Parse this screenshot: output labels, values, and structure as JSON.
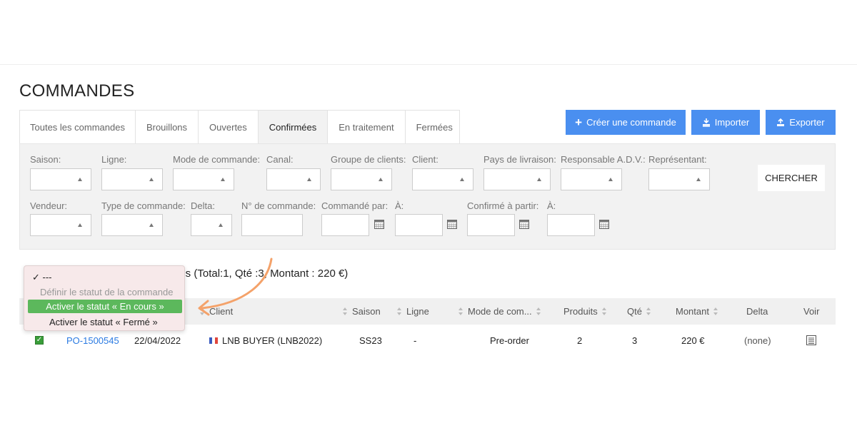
{
  "page": {
    "title": "COMMANDES"
  },
  "tabs": [
    {
      "label": "Toutes les commandes"
    },
    {
      "label": "Brouillons"
    },
    {
      "label": "Ouvertes"
    },
    {
      "label": "Confirmées"
    },
    {
      "label": "En traitement"
    },
    {
      "label": "Fermées"
    }
  ],
  "actions": {
    "create": "Créer une commande",
    "import": "Importer",
    "export": "Exporter"
  },
  "filters": {
    "saison": "Saison:",
    "ligne": "Ligne:",
    "mode": "Mode de commande:",
    "canal": "Canal:",
    "groupe": "Groupe de clients:",
    "client": "Client:",
    "pays": "Pays de livraison:",
    "responsable": "Responsable A.D.V.:",
    "representant": "Représentant:",
    "vendeur": "Vendeur:",
    "type": "Type de commande:",
    "delta": "Delta:",
    "numero": "N° de commande:",
    "commande_par": "Commandé par:",
    "a1": "À:",
    "confirme": "Confirmé à partir:",
    "a2": "À:",
    "search_button": "CHERCHER"
  },
  "summary": "ées (Total:1, Qté :3, Montant : 220 €)",
  "dropdown": {
    "selected": "✓ ---",
    "header": "Définir le statut de la commande",
    "option1": "Activer le statut « En cours »",
    "option2": "Activer le statut « Fermé »"
  },
  "table": {
    "headers": {
      "client": "Client",
      "saison": "Saison",
      "ligne": "Ligne",
      "mode": "Mode de com...",
      "produits": "Produits",
      "qte": "Qté",
      "montant": "Montant",
      "delta": "Delta",
      "voir": "Voir"
    },
    "row": {
      "order": "PO-1500545",
      "date": "22/04/2022",
      "client": "LNB BUYER (LNB2022)",
      "saison": "SS23",
      "ligne": "-",
      "mode": "Pre-order",
      "produits": "2",
      "qte": "3",
      "montant": "220 €",
      "delta": "(none)"
    }
  },
  "colors": {
    "accent_blue": "#4a8ff0",
    "highlight_green": "#5cb85c",
    "arrow_orange": "#f4a26a",
    "link_blue": "#2a7ae2"
  }
}
